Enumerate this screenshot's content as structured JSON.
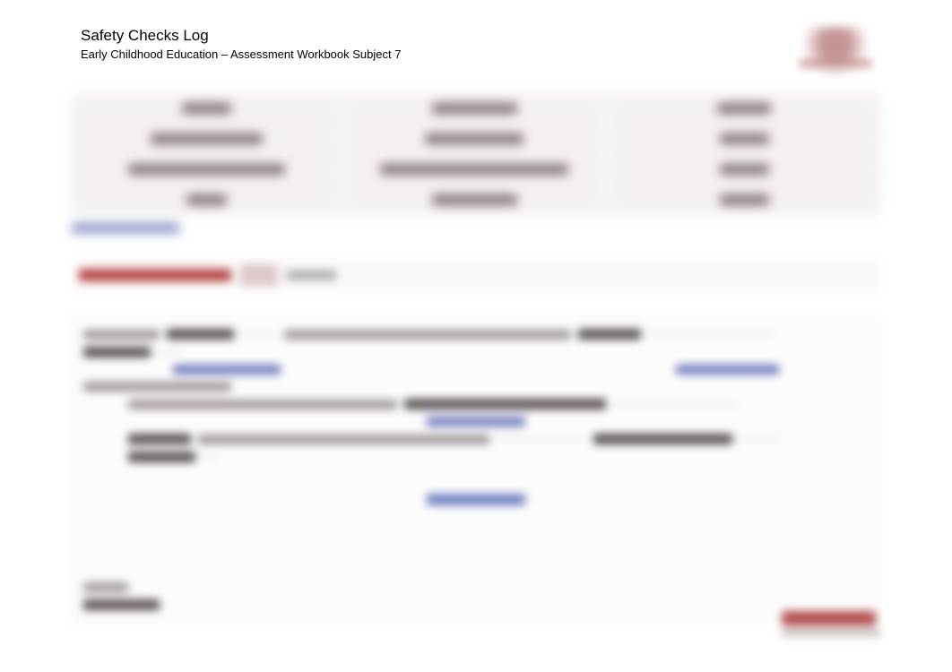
{
  "header": {
    "title": "Safety Checks Log",
    "subtitle": "Early Childhood Education – Assessment Workbook Subject 7"
  }
}
